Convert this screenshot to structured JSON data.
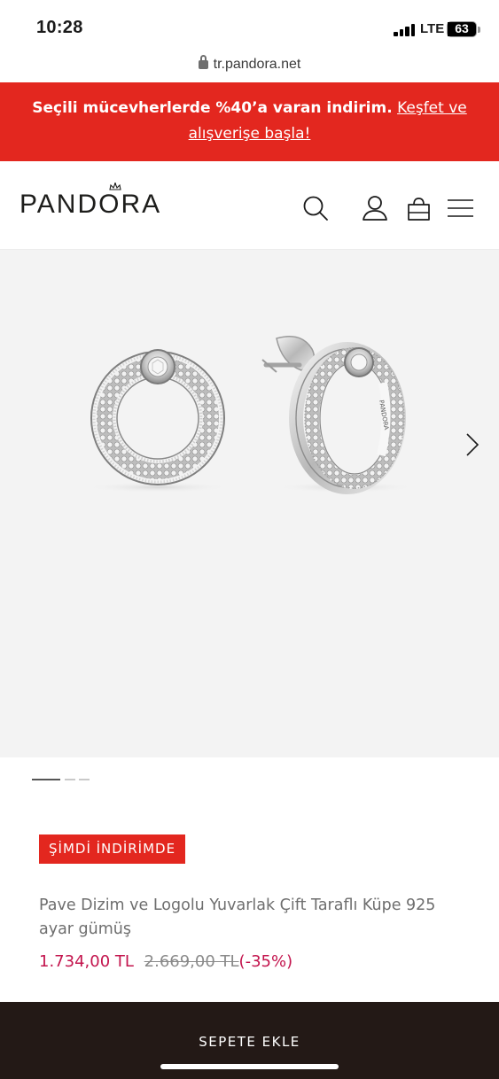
{
  "status_bar": {
    "time": "10:28",
    "network": "LTE",
    "battery_percent": 63
  },
  "browser": {
    "url": "tr.pandora.net"
  },
  "promo": {
    "text": "Seçili mücevherlerde %40’a varan indirim.",
    "link_text": "Keşfet ve alışverişe başla!"
  },
  "header": {
    "logo_text": "PANDORA",
    "icons": [
      "search-icon",
      "account-icon",
      "shopping-bag-icon",
      "menu-icon"
    ]
  },
  "gallery": {
    "image_count": 3,
    "active_index": 0,
    "ring_engraving": "PANDORA"
  },
  "product": {
    "badge": "ŞİMDİ İNDİRİMDE",
    "name": "Pave Dizim ve Logolu Yuvarlak Çift Taraflı Küpe 925 ayar gümüş",
    "price_current": "1.734,00 TL",
    "price_old": "2.669,00 TL",
    "discount": "(-35%)"
  },
  "cart": {
    "button_label": "SEPETE EKLE"
  },
  "colors": {
    "promo_background": "#e3271f",
    "price_accent": "#c3144d",
    "cart_background": "#231916",
    "gallery_background": "#f3f3f3"
  }
}
